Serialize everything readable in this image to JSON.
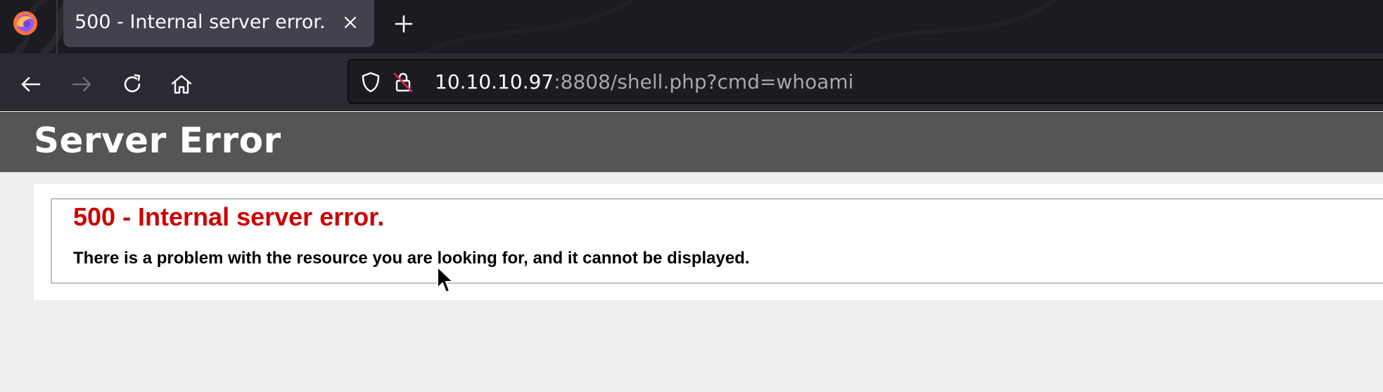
{
  "browser": {
    "logo_icon": "firefox-icon",
    "tabs": [
      {
        "title": "500 - Internal server error.",
        "active": true
      }
    ],
    "nav": {
      "back_icon": "arrow-left-icon",
      "forward_icon": "arrow-right-icon",
      "reload_icon": "reload-icon",
      "home_icon": "home-icon"
    },
    "urlbar": {
      "host": "10.10.10.97",
      "rest": ":8808/shell.php?cmd=whoami",
      "shield_icon": "shield-icon",
      "lock_icon": "insecure-lock-icon"
    }
  },
  "page": {
    "header_title": "Server Error",
    "error_title": "500 - Internal server error.",
    "error_message": "There is a problem with the resource you are looking for, and it cannot be displayed."
  },
  "colors": {
    "header_bg": "#555555",
    "error_red": "#cc0000",
    "page_bg": "#eeeeee",
    "toolbar_bg": "#2b2a33",
    "tabstrip_bg": "#1c1b22"
  }
}
